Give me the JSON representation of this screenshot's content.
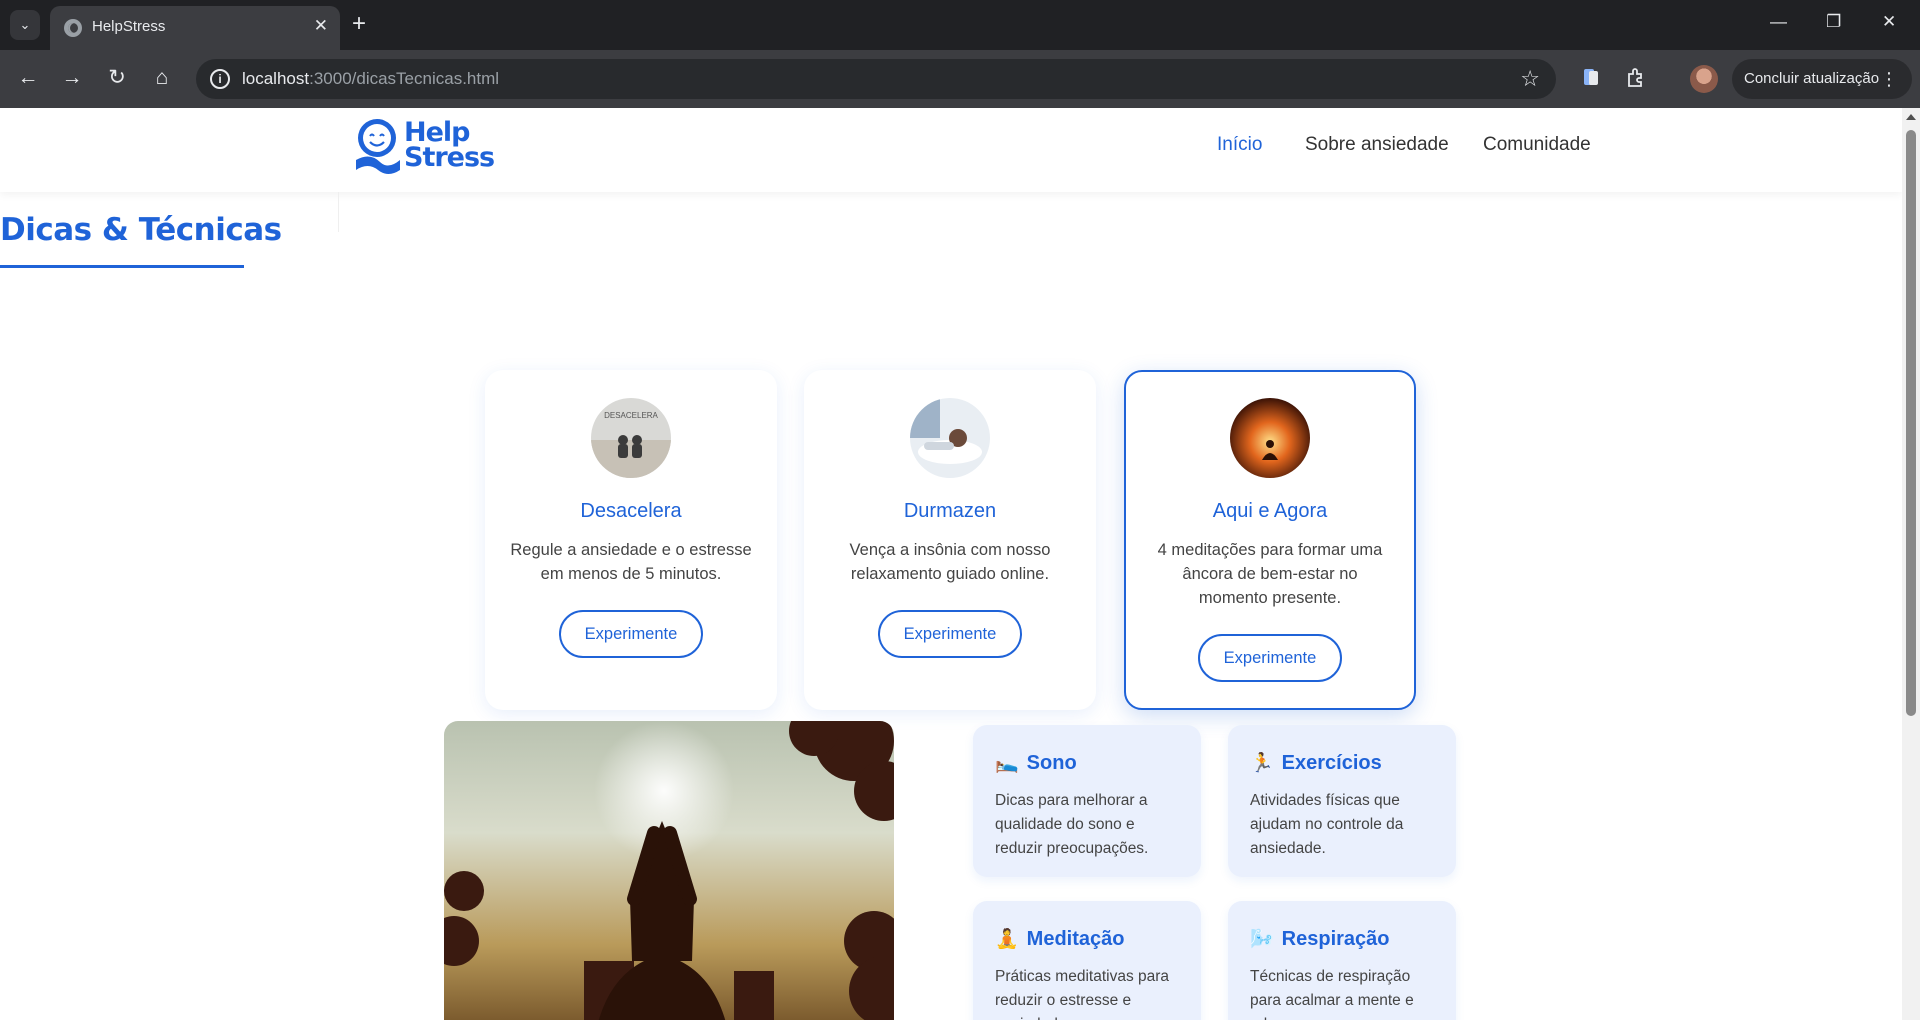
{
  "browser": {
    "tab_title": "HelpStress",
    "url_host": "localhost",
    "url_path": ":3000/dicasTecnicas.html",
    "update_label": "Concluir atualização"
  },
  "header": {
    "logo_line1": "Help",
    "logo_line2": "Stress",
    "nav": [
      {
        "label": "Início"
      },
      {
        "label": "Sobre ansiedade"
      },
      {
        "label": "Comunidade"
      }
    ]
  },
  "page": {
    "title": "Dicas & Técnicas"
  },
  "cards": [
    {
      "title": "Desacelera",
      "desc": "Regule a ansiedade e o estresse em menos de 5 minutos.",
      "button": "Experimente",
      "image_text": "DESACELERA"
    },
    {
      "title": "Durmazen",
      "desc": "Vença a insônia com nosso relaxamento guiado online.",
      "button": "Experimente"
    },
    {
      "title": "Aqui e Agora",
      "desc": "4 meditações para formar uma âncora de bem-estar no momento presente.",
      "button": "Experimente"
    }
  ],
  "tips": [
    {
      "emoji": "🛌",
      "title": "Sono",
      "desc": "Dicas para melhorar a qualidade do sono e reduzir preocupações."
    },
    {
      "emoji": "🏃",
      "title": "Exercícios",
      "desc": "Atividades físicas que ajudam no controle da ansiedade."
    },
    {
      "emoji": "🧘",
      "title": "Meditação",
      "desc": "Práticas meditativas para reduzir o estresse e ansiedade."
    },
    {
      "emoji": "🌬️",
      "title": "Respiração",
      "desc": "Técnicas de respiração para acalmar a mente e relaxar o corpo."
    }
  ],
  "colors": {
    "brand": "#1f63d8",
    "tip_background": "#eaf0fd"
  }
}
